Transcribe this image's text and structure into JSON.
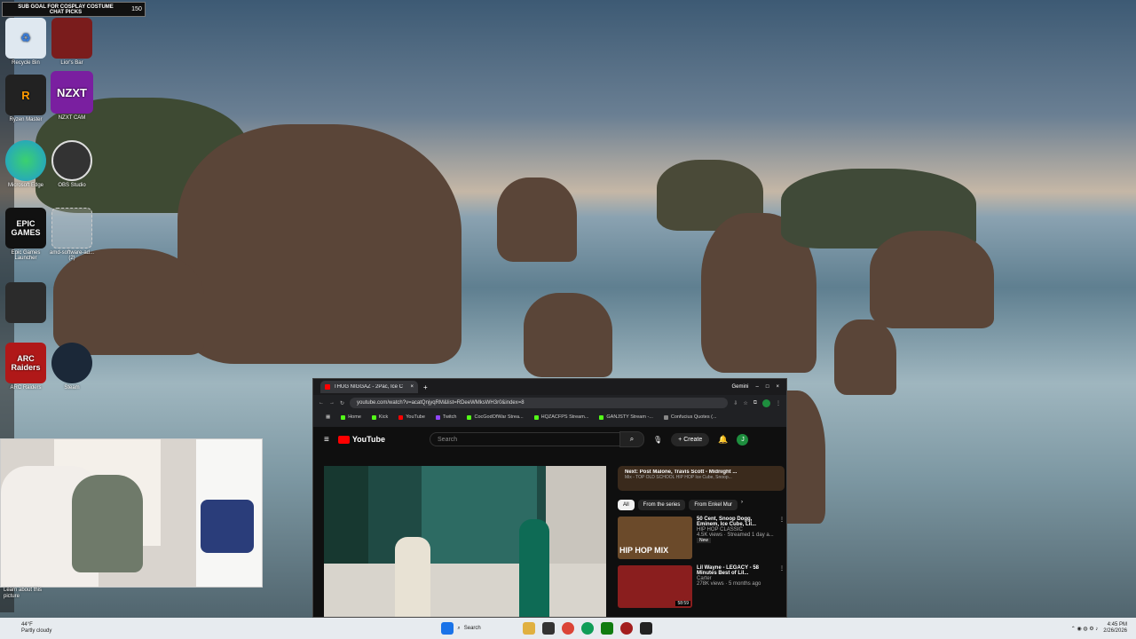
{
  "overlay": {
    "goal_text": "SUB GOAL FOR COSPLAY COSTUME\nCHAT PICKS",
    "goal_count": "150"
  },
  "desktop_icons": [
    {
      "label": "Recycle Bin",
      "color": "#dfe8f0"
    },
    {
      "label": "Lior's Bar",
      "color": "#7a1c1c"
    },
    {
      "label": "Ryzen Master",
      "color": "#222"
    },
    {
      "label": "NZXT CAM",
      "color": "#7a1fa0",
      "text": "NZXT"
    },
    {
      "label": "Microsoft Edge",
      "color": "#1f9ad6"
    },
    {
      "label": "OBS Studio",
      "color": "#333"
    },
    {
      "label": "Epic Games Launcher",
      "color": "#111",
      "text": "EPIC GAMES"
    },
    {
      "label": "amd-software-ad... (2)",
      "color": "#ddd"
    },
    {
      "label": "",
      "color": "#2b2b2b"
    },
    {
      "label": "ARC Raiders",
      "color": "#b01818",
      "text": "ARC Raiders"
    },
    {
      "label": "Steam",
      "color": "#1b2838"
    }
  ],
  "webcam": {
    "learn_text": "Learn about this picture"
  },
  "browser": {
    "tab_title": "THUG NIGGAZ - 2Pac, Ice C",
    "tab_close": "×",
    "new_tab": "+",
    "gemini_label": "Gemini",
    "url": "youtube.com/watch?v=acatQnjyqRM&list=RDeeWMksWH3r0&index=8",
    "bookmarks": [
      {
        "label": "Home",
        "color": "#53fc18"
      },
      {
        "label": "Kick",
        "color": "#53fc18"
      },
      {
        "label": "YouTube",
        "color": "#ff0000"
      },
      {
        "label": "Twitch",
        "color": "#9146ff"
      },
      {
        "label": "CocGodOfWar Strea...",
        "color": "#53fc18"
      },
      {
        "label": "HQZACFPS Stream...",
        "color": "#53fc18"
      },
      {
        "label": "GANJSTY Stream -...",
        "color": "#53fc18"
      },
      {
        "label": "Confucius Quotes (...",
        "color": "#888888"
      }
    ]
  },
  "youtube": {
    "logo": "YouTube",
    "search_placeholder": "Search",
    "create_label": "Create",
    "avatar_letter": "J",
    "next_title": "Next: Post Malone, Travis Scott - Midnight ...",
    "next_sub": "Mix - TOP OLD SCHOOL HIP HOP Ice Cube, Snoop...",
    "chips": [
      "All",
      "From the series",
      "From Enkel Mur"
    ],
    "videos": [
      {
        "title": "50 Cent, Snoop Dogg, Eminem, Ice Cube, Lil...",
        "channel": "HIP HOP CLASSIC",
        "meta": "4.5K views · Streamed 1 day a...",
        "badge": "New",
        "thumb_text": "HIP HOP MIX"
      },
      {
        "title": "Lil Wayne - LEGACY - 58 Minutes Best of Lil...",
        "channel": "Carter",
        "meta": "278K views · 5 months ago",
        "duration": "58:59"
      }
    ]
  },
  "taskbar": {
    "weather_temp": "44°F",
    "weather_desc": "Partly cloudy",
    "search_label": "Search",
    "time": "4:45 PM",
    "date": "2/26/2026"
  }
}
